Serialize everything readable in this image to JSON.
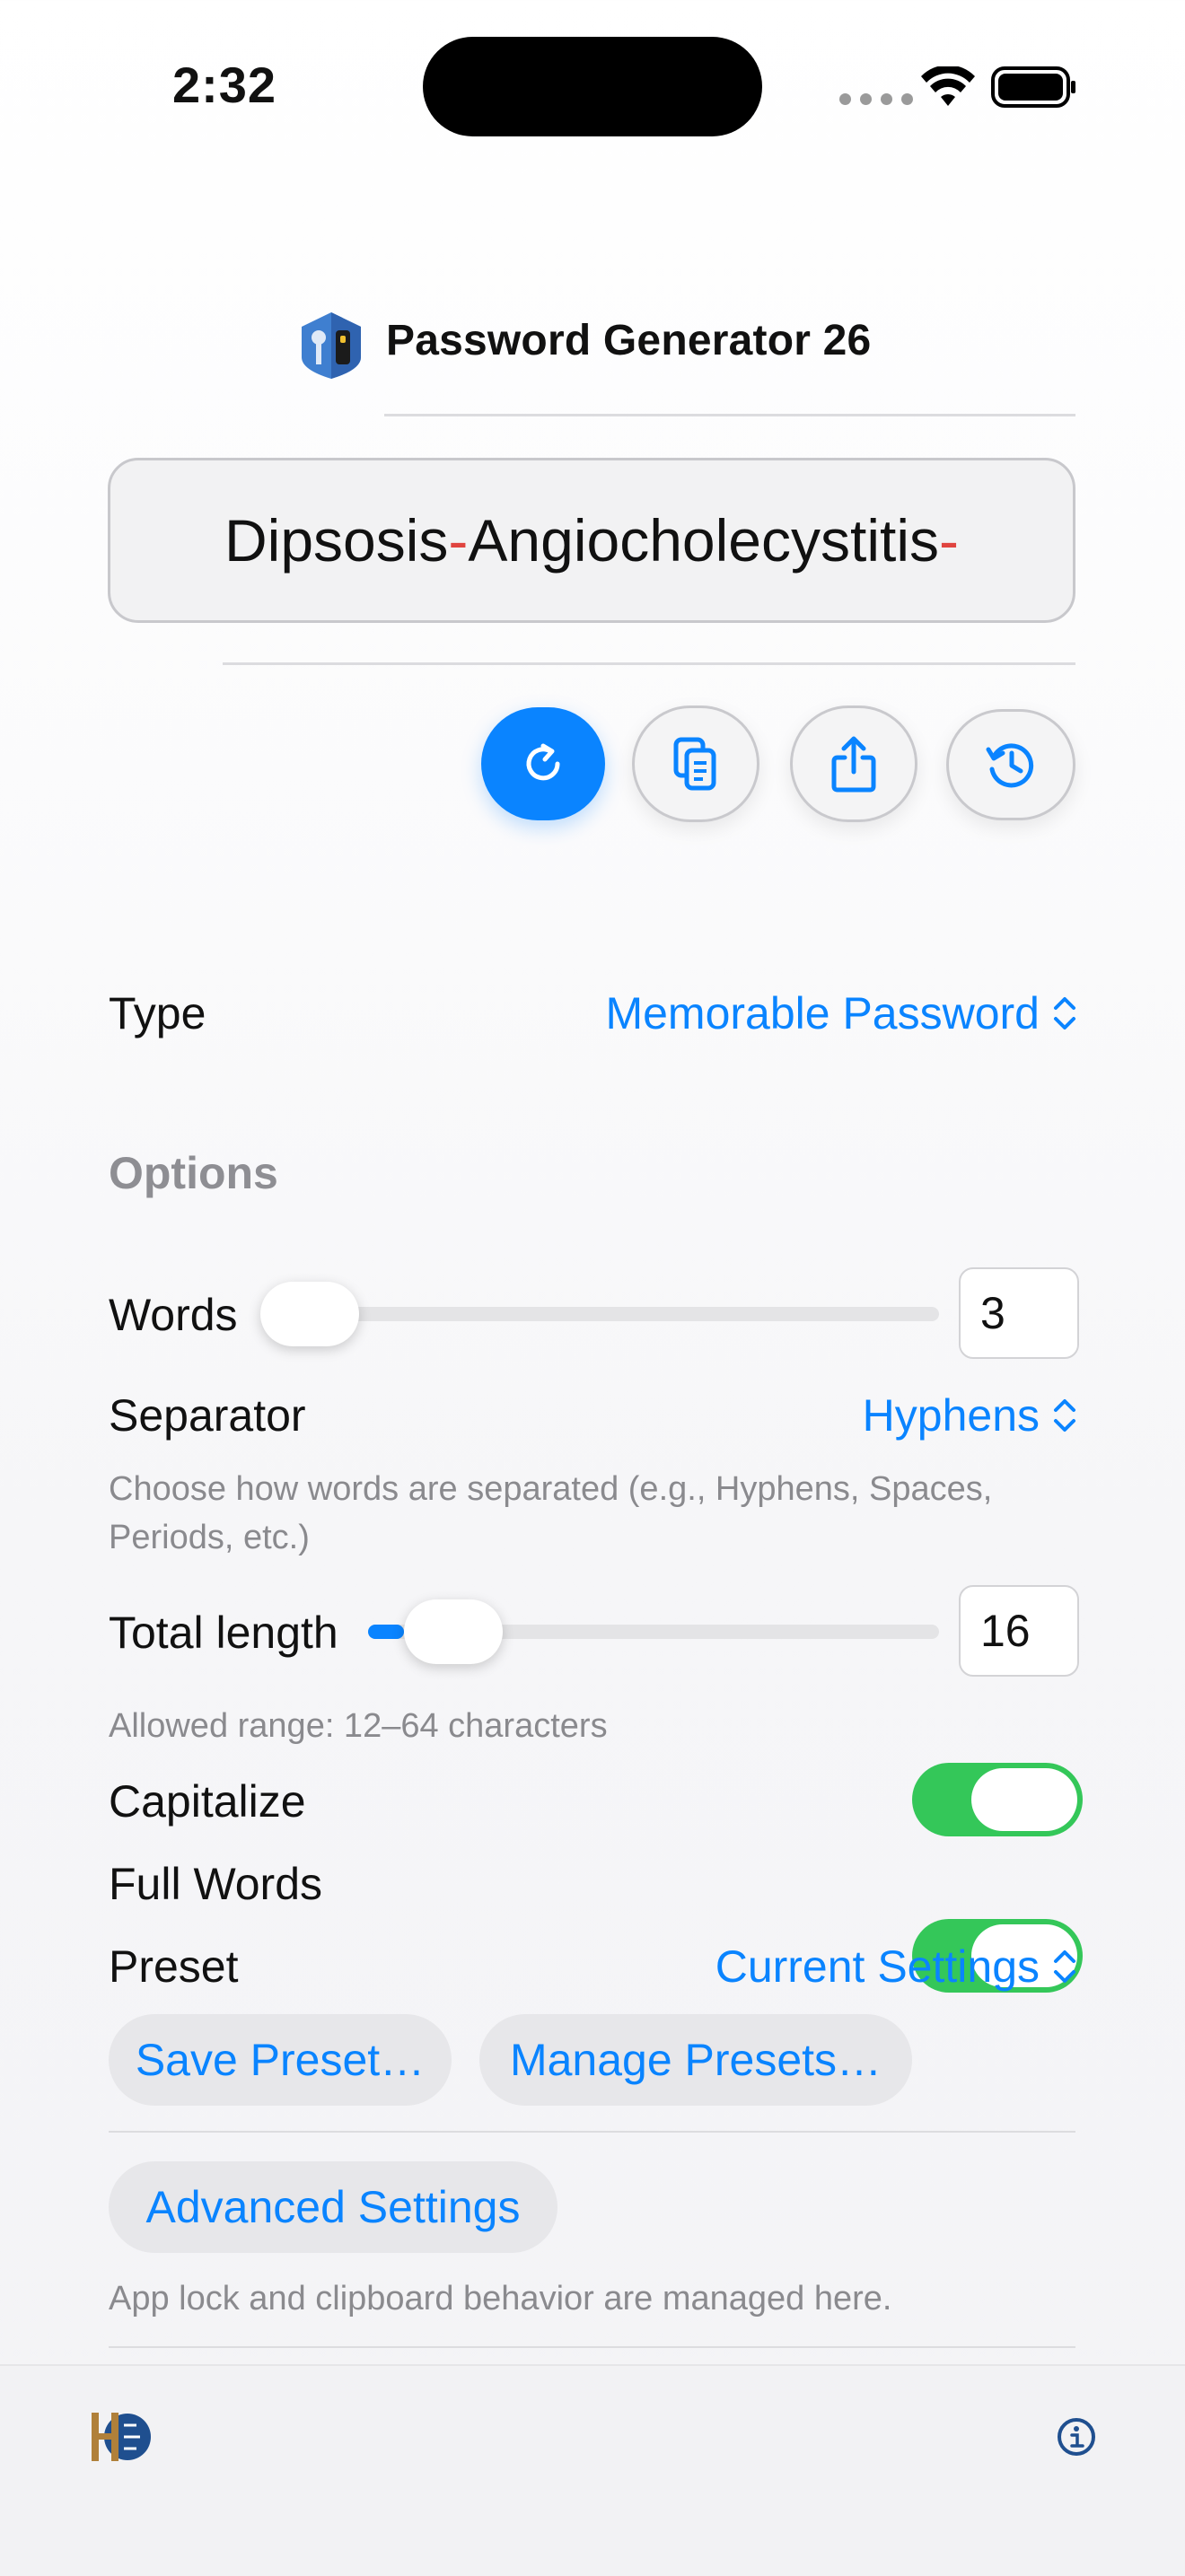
{
  "status_bar": {
    "time": "2:32"
  },
  "header": {
    "title": "Password Generator 26"
  },
  "password": {
    "parts": [
      "Dipsosis",
      "-",
      "Angiocholecystitis",
      "-"
    ]
  },
  "actions": [
    {
      "name": "regenerate",
      "icon": "refresh-icon"
    },
    {
      "name": "copy",
      "icon": "copy-icon"
    },
    {
      "name": "share",
      "icon": "share-icon"
    },
    {
      "name": "history",
      "icon": "history-icon"
    }
  ],
  "type": {
    "label": "Type",
    "value": "Memorable Password"
  },
  "options": {
    "section_label": "Options",
    "words": {
      "label": "Words",
      "value": "3",
      "level": 0.0
    },
    "separator": {
      "label": "Separator",
      "value": "Hyphens",
      "help": "Choose how words are separated (e.g., Hyphens, Spaces, Periods, etc.)"
    },
    "total_length": {
      "label": "Total length",
      "value": "16",
      "help": "Allowed range: 12–64 characters",
      "level": 0.077
    },
    "capitalize": {
      "label": "Capitalize",
      "on": true
    },
    "full_words": {
      "label": "Full Words",
      "on": true
    },
    "preset": {
      "label": "Preset",
      "value": "Current Settings"
    },
    "save_preset": "Save Preset…",
    "manage_presets": "Manage Presets…",
    "advanced_settings": "Advanced Settings",
    "advanced_help": "App lock and clipboard behavior are managed here."
  },
  "colors": {
    "accent": "#0a84ff",
    "toggle_on": "#34c759",
    "separator_red": "#e0443f"
  }
}
